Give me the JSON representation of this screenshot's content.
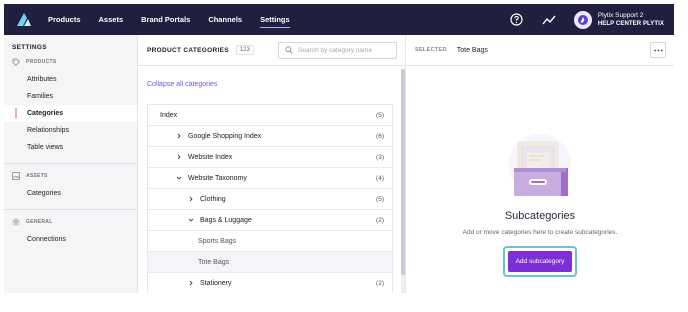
{
  "topbar": {
    "nav": [
      "Products",
      "Assets",
      "Brand Portals",
      "Channels",
      "Settings"
    ],
    "active": "Settings",
    "user_name": "Plytix Support 2",
    "user_org": "HELP CENTER PLYTIX",
    "icons": [
      "plytix-logo-icon",
      "help-circle-icon",
      "activity-icon",
      "user-avatar-icon"
    ]
  },
  "sidebar": {
    "title": "SETTINGS",
    "sections": [
      {
        "label": "PRODUCTS",
        "icon": "tag-icon",
        "items": [
          "Attributes",
          "Families",
          "Categories",
          "Relationships",
          "Table views"
        ]
      },
      {
        "label": "ASSETS",
        "icon": "image-icon",
        "items": [
          "Categories"
        ]
      },
      {
        "label": "GENERAL",
        "icon": "gear-icon",
        "items": [
          "Connections"
        ]
      }
    ],
    "active_item": "Categories"
  },
  "categories_panel": {
    "title": "PRODUCT CATEGORIES",
    "count": "123",
    "search_placeholder": "Search by category name",
    "collapse_label": "Collapse all categories",
    "rows": [
      {
        "label": "Index",
        "count": "(5)",
        "level": 0,
        "expander": "none"
      },
      {
        "label": "Google Shopping Index",
        "count": "(6)",
        "level": 1,
        "expander": "collapsed"
      },
      {
        "label": "Website Index",
        "count": "(3)",
        "level": 1,
        "expander": "collapsed"
      },
      {
        "label": "Website Taxonomy",
        "count": "(4)",
        "level": 1,
        "expander": "expanded"
      },
      {
        "label": "Clothing",
        "count": "(5)",
        "level": 2,
        "expander": "collapsed"
      },
      {
        "label": "Bags & Luggage",
        "count": "(2)",
        "level": 2,
        "expander": "expanded"
      },
      {
        "label": "Sports Bags",
        "count": "",
        "level": 3,
        "expander": "none"
      },
      {
        "label": "Tote Bags",
        "count": "",
        "level": 3,
        "expander": "none",
        "selected": true
      },
      {
        "label": "Stationery",
        "count": "(2)",
        "level": 2,
        "expander": "collapsed"
      }
    ]
  },
  "detail_panel": {
    "selected_label": "SELECTED",
    "selected_value": "Tote Bags",
    "more_icon": "more-horizontal-icon",
    "title": "Subcategories",
    "description": "Add or move categories here to create subcategories.",
    "button_label": "Add subcategory",
    "illustration": "drawer-illustration-icon"
  },
  "colors": {
    "topbar_bg": "#211f3f",
    "accent": "#7b2fd4",
    "link": "#7b52d9",
    "highlight_ring": "#62c7d9",
    "active_marker": "#f0a9a1"
  }
}
